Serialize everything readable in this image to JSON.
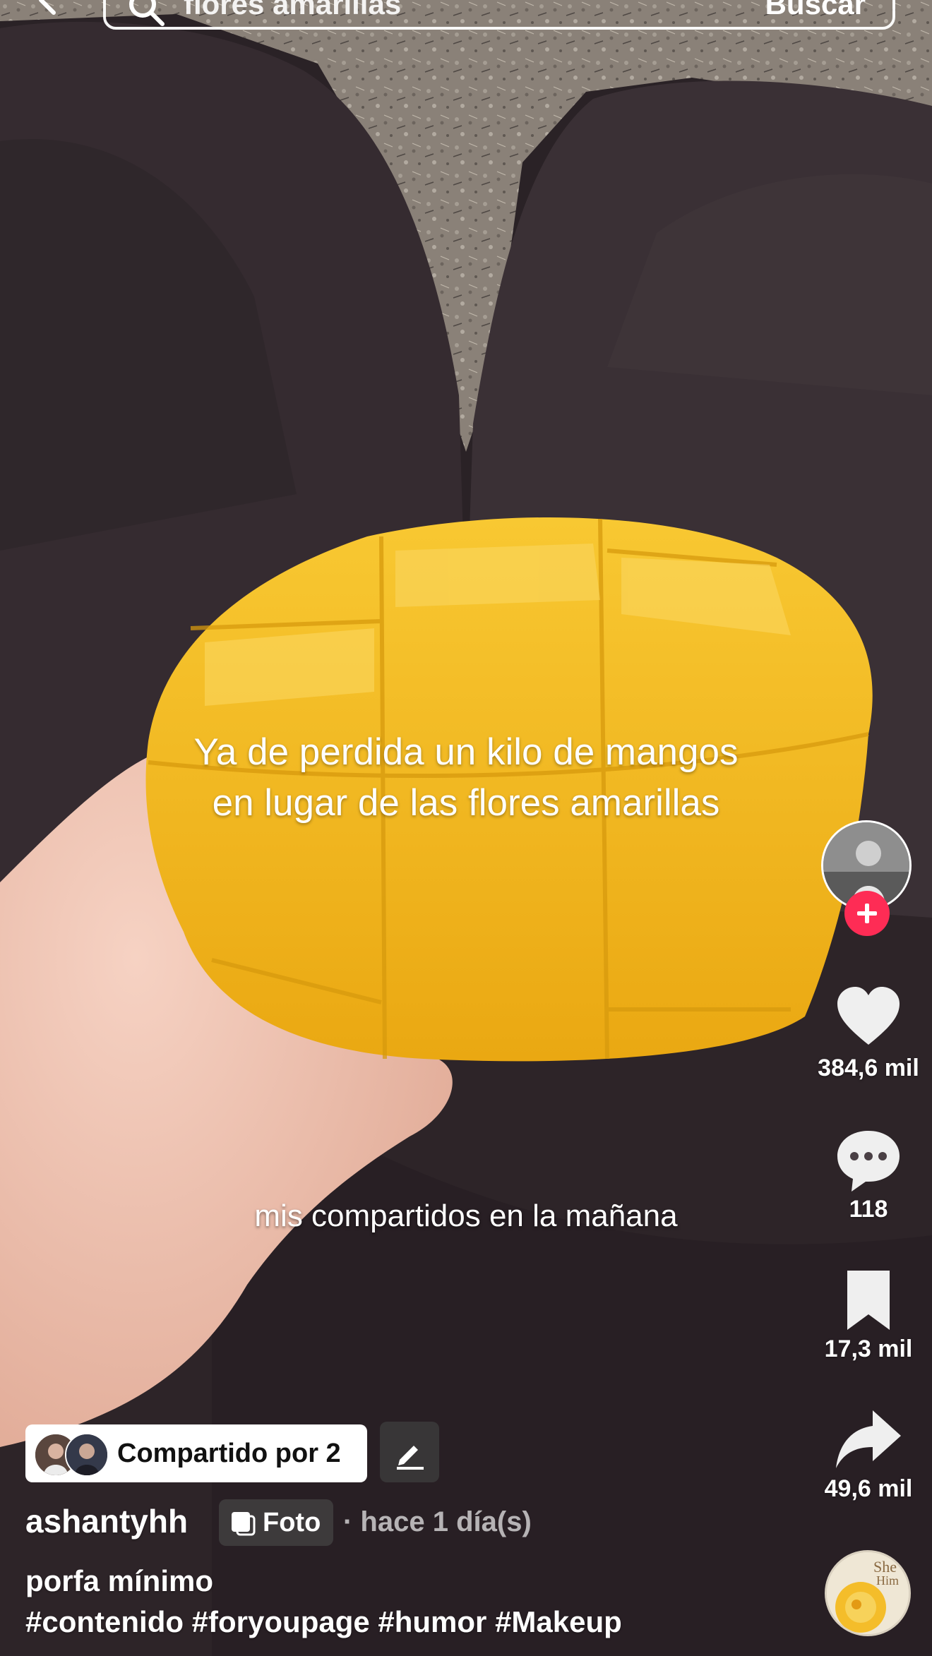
{
  "search": {
    "value": "flores amarillas",
    "button_label": "Buscar"
  },
  "post": {
    "overlay_text": "Ya de perdida un kilo de mangos en lugar de las flores amarillas",
    "caption": "mis compartidos en la mañana"
  },
  "actions": {
    "likes": "384,6 mil",
    "comments": "118",
    "saves": "17,3 mil",
    "shares": "49,6 mil"
  },
  "shared": {
    "label": "Compartido por 2"
  },
  "author": {
    "username": "ashantyhh",
    "badge": "Foto",
    "time": "· hace 1 día(s)"
  },
  "description": "porfa mínimo",
  "hashtags": "#contenido #foryoupage #humor #Makeup",
  "colors": {
    "like_accent": "#fe2c55",
    "mango": "#f5b814",
    "pants": "#2e2327",
    "gravel": "#8c8379"
  },
  "icons": [
    "back-icon",
    "search-icon",
    "heart-icon",
    "comment-icon",
    "bookmark-icon",
    "share-icon",
    "pencil-icon",
    "photo-icon",
    "plus-icon"
  ]
}
